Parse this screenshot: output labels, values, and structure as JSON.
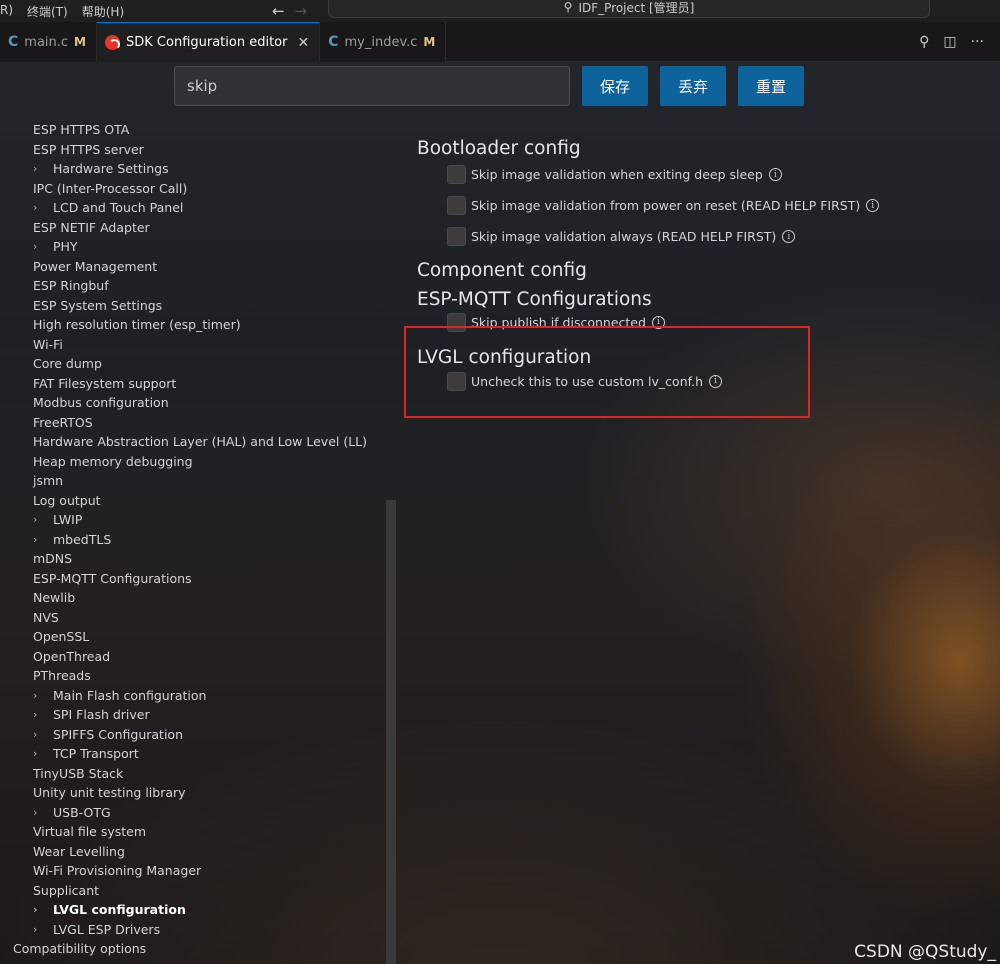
{
  "titlebar": {
    "menu": [
      "R)",
      "终端(T)",
      "帮助(H)"
    ],
    "command_center": "IDF_Project [管理员]"
  },
  "tabs": [
    {
      "label": "main.c",
      "badge": "M",
      "icon": "c-file-icon"
    },
    {
      "label": "SDK Configuration editor",
      "badge": "",
      "icon": "esp-icon"
    },
    {
      "label": "my_indev.c",
      "badge": "M",
      "icon": "c-file-icon"
    }
  ],
  "search": {
    "value": "skip",
    "placeholder": ""
  },
  "buttons": {
    "save": "保存",
    "discard": "丢弃",
    "reset": "重置"
  },
  "tree": [
    {
      "label": "ESP HTTPS OTA",
      "expandable": false
    },
    {
      "label": "ESP HTTPS server",
      "expandable": false
    },
    {
      "label": "Hardware Settings",
      "expandable": true
    },
    {
      "label": "IPC (Inter-Processor Call)",
      "expandable": false
    },
    {
      "label": "LCD and Touch Panel",
      "expandable": true
    },
    {
      "label": "ESP NETIF Adapter",
      "expandable": false
    },
    {
      "label": "PHY",
      "expandable": true
    },
    {
      "label": "Power Management",
      "expandable": false
    },
    {
      "label": "ESP Ringbuf",
      "expandable": false
    },
    {
      "label": "ESP System Settings",
      "expandable": false
    },
    {
      "label": "High resolution timer (esp_timer)",
      "expandable": false
    },
    {
      "label": "Wi-Fi",
      "expandable": false
    },
    {
      "label": "Core dump",
      "expandable": false
    },
    {
      "label": "FAT Filesystem support",
      "expandable": false
    },
    {
      "label": "Modbus configuration",
      "expandable": false
    },
    {
      "label": "FreeRTOS",
      "expandable": false
    },
    {
      "label": "Hardware Abstraction Layer (HAL) and Low Level (LL)",
      "expandable": false
    },
    {
      "label": "Heap memory debugging",
      "expandable": false
    },
    {
      "label": "jsmn",
      "expandable": false
    },
    {
      "label": "Log output",
      "expandable": false
    },
    {
      "label": "LWIP",
      "expandable": true
    },
    {
      "label": "mbedTLS",
      "expandable": true
    },
    {
      "label": "mDNS",
      "expandable": false
    },
    {
      "label": "ESP-MQTT Configurations",
      "expandable": false
    },
    {
      "label": "Newlib",
      "expandable": false
    },
    {
      "label": "NVS",
      "expandable": false
    },
    {
      "label": "OpenSSL",
      "expandable": false
    },
    {
      "label": "OpenThread",
      "expandable": false
    },
    {
      "label": "PThreads",
      "expandable": false
    },
    {
      "label": "Main Flash configuration",
      "expandable": true
    },
    {
      "label": "SPI Flash driver",
      "expandable": true
    },
    {
      "label": "SPIFFS Configuration",
      "expandable": true
    },
    {
      "label": "TCP Transport",
      "expandable": true
    },
    {
      "label": "TinyUSB Stack",
      "expandable": false
    },
    {
      "label": "Unity unit testing library",
      "expandable": false
    },
    {
      "label": "USB-OTG",
      "expandable": true
    },
    {
      "label": "Virtual file system",
      "expandable": false
    },
    {
      "label": "Wear Levelling",
      "expandable": false
    },
    {
      "label": "Wi-Fi Provisioning Manager",
      "expandable": false
    },
    {
      "label": "Supplicant",
      "expandable": false
    },
    {
      "label": "LVGL configuration",
      "expandable": true,
      "bold": true
    },
    {
      "label": "LVGL ESP Drivers",
      "expandable": true
    },
    {
      "label": "Compatibility options",
      "expandable": false,
      "outdent": true
    }
  ],
  "content": {
    "bootloader": {
      "title": "Bootloader config",
      "options": [
        "Skip image validation when exiting deep sleep",
        "Skip image validation from power on reset (READ HELP FIRST)",
        "Skip image validation always (READ HELP FIRST)"
      ]
    },
    "component_title": "Component config",
    "mqtt": {
      "title": "ESP-MQTT Configurations",
      "options": [
        "Skip publish if disconnected"
      ]
    },
    "lvgl": {
      "title": "LVGL configuration",
      "options": [
        "Uncheck this to use custom lv_conf.h"
      ]
    }
  },
  "watermark": "CSDN @QStudy_",
  "colors": {
    "accent": "#0e639c",
    "highlight": "#e02424"
  }
}
